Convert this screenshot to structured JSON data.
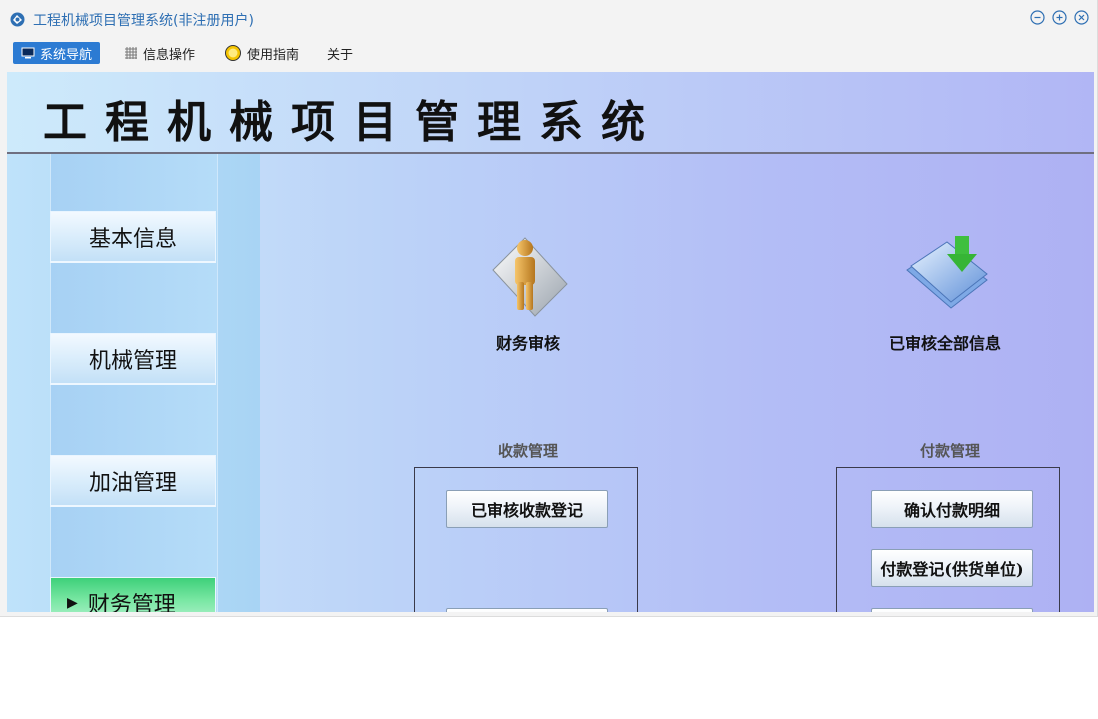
{
  "window": {
    "title": "工程机械项目管理系统(非注册用户)"
  },
  "menu": {
    "items": [
      {
        "label": "系统导航",
        "icon": "monitor-icon"
      },
      {
        "label": "信息操作",
        "icon": "grid-icon"
      },
      {
        "label": "使用指南",
        "icon": "lightbulb-icon"
      },
      {
        "label": "关于",
        "icon": ""
      }
    ]
  },
  "banner": {
    "title": "工程机械项目管理系统"
  },
  "sidebar": {
    "items": [
      {
        "label": "基本信息"
      },
      {
        "label": "机械管理"
      },
      {
        "label": "加油管理"
      },
      {
        "label": "财务管理",
        "active": true
      }
    ]
  },
  "main": {
    "shortcuts": [
      {
        "label": "财务审核",
        "icon": "person-document-icon"
      },
      {
        "label": "已审核全部信息",
        "icon": "document-download-icon"
      }
    ],
    "groups": [
      {
        "label": "收款管理",
        "buttons": [
          "已审核收款登记",
          ""
        ]
      },
      {
        "label": "付款管理",
        "buttons": [
          "确认付款明细",
          "付款登记(供货单位)",
          ""
        ]
      }
    ]
  },
  "colors": {
    "accent": "#2c7bd3",
    "title_text": "#2e6fb3",
    "active_nav": "#3ed07a"
  }
}
